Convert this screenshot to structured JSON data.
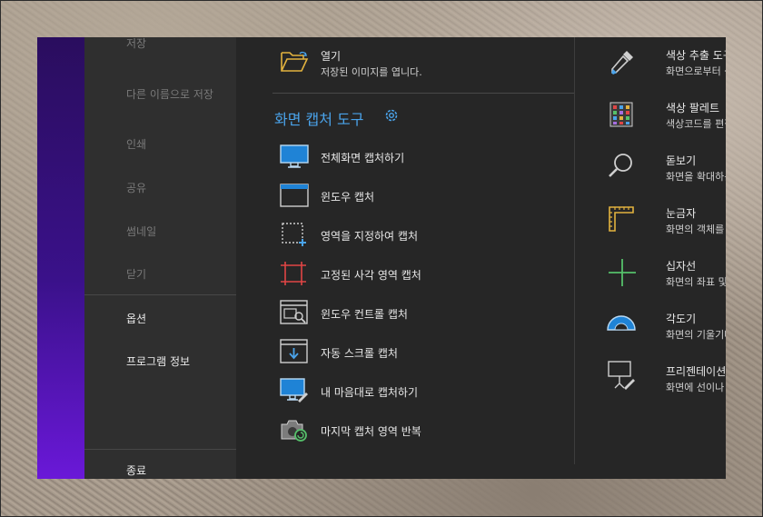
{
  "sidebar": {
    "items": [
      {
        "label": "저장"
      },
      {
        "label": "다른 이름으로 저장"
      },
      {
        "label": "인쇄"
      },
      {
        "label": "공유"
      },
      {
        "label": "썸네일"
      },
      {
        "label": "닫기"
      },
      {
        "label": "옵션"
      },
      {
        "label": "프로그램 정보"
      },
      {
        "label": "종료"
      }
    ]
  },
  "open": {
    "label": "열기",
    "desc": "저장된 이미지를 엽니다."
  },
  "capture_section": {
    "title": "화면 캡처 도구",
    "items": [
      {
        "label": "전체화면 캡처하기"
      },
      {
        "label": "윈도우 캡처"
      },
      {
        "label": "영역을 지정하여 캡처"
      },
      {
        "label": "고정된 사각 영역 캡처"
      },
      {
        "label": "윈도우 컨트롤 캡처"
      },
      {
        "label": "자동 스크롤 캡처"
      },
      {
        "label": "내 마음대로 캡처하기"
      },
      {
        "label": "마지막 캡처 영역 반복"
      }
    ]
  },
  "tools": [
    {
      "label": "색상 추출 도구",
      "desc": "화면으로부터 색"
    },
    {
      "label": "색상 팔레트",
      "desc": "색상코드를 편집"
    },
    {
      "label": "돋보기",
      "desc": "화면을 확대하는"
    },
    {
      "label": "눈금자",
      "desc": "화면의 객체를 픽"
    },
    {
      "label": "십자선",
      "desc": "화면의 좌표 및 상"
    },
    {
      "label": "각도기",
      "desc": "화면의 기울기나"
    },
    {
      "label": "프리젠테이션 도",
      "desc": "화면에 선이나 도"
    }
  ],
  "colors": {
    "accent": "#4aa3ea",
    "panel": "#262626",
    "sidebar": "#2f2f2f",
    "brand": "#3a118a"
  }
}
